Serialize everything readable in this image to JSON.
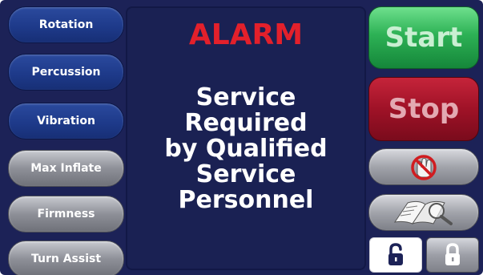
{
  "left_buttons": {
    "rotation": "Rotation",
    "percussion": "Percussion",
    "vibration": "Vibration",
    "max_inflate": "Max Inflate",
    "firmness": "Firmness",
    "turn_assist": "Turn Assist"
  },
  "alarm": {
    "title": "ALARM",
    "message_line1": "Service Required",
    "message_line2": "by Qualified",
    "message_line3": "Service Personnel"
  },
  "right_buttons": {
    "start": "Start",
    "stop": "Stop",
    "no_entry_icon": "no-touch-icon",
    "manual_icon": "manual-search-icon",
    "unlock_icon": "unlock-icon",
    "lock_icon": "lock-icon"
  },
  "colors": {
    "background": "#1c2257",
    "alarm_red": "#e3202b",
    "start_green": "#2db155",
    "stop_red": "#9f1227",
    "blue_button": "#1e3a8a",
    "gray_button": "#8e9098"
  }
}
